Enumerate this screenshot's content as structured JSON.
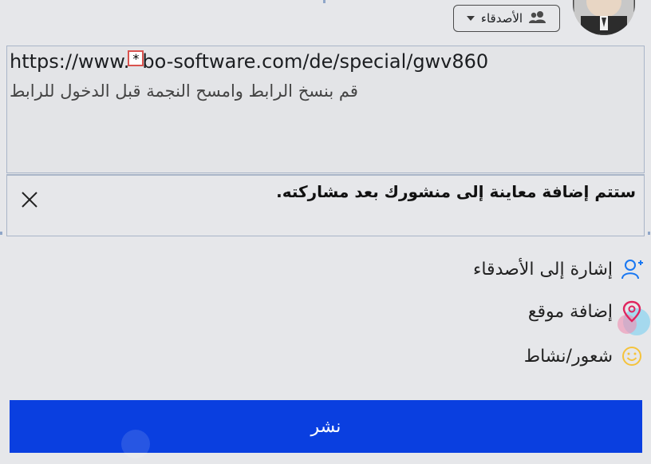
{
  "header": {
    "audience_label": "الأصدقاء",
    "audience_icon": "friends-icon"
  },
  "compose": {
    "url_prefix": "https://www.",
    "url_star": "*",
    "url_suffix": "bo-software.com/de/special/gwv860",
    "hint": "قم بنسخ الرابط وامسح النجمة قبل الدخول للرابط"
  },
  "preview": {
    "message": "ستتم إضافة معاينة إلى منشورك بعد مشاركته."
  },
  "actions": [
    {
      "label": "إشارة إلى الأصدقاء",
      "icon": "tag-friends-icon",
      "color": "#1877f2"
    },
    {
      "label": "إضافة موقع",
      "icon": "location-pin-icon",
      "color": "#e0245e"
    },
    {
      "label": "شعور/نشاط",
      "icon": "smiley-icon",
      "color": "#f5c33b"
    }
  ],
  "post_button": {
    "label": "نشر",
    "color": "#0a3fe0"
  }
}
